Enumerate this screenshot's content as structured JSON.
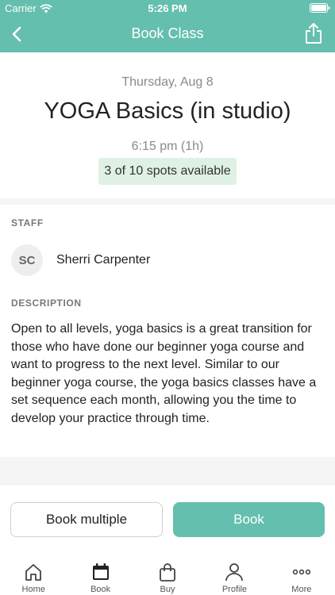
{
  "status_bar": {
    "carrier": "Carrier",
    "time": "5:26 PM"
  },
  "nav": {
    "title": "Book Class"
  },
  "class": {
    "date": "Thursday, Aug 8",
    "title": "YOGA Basics (in studio)",
    "time": "6:15 pm (1h)",
    "spots": "3 of 10 spots available"
  },
  "staff": {
    "label": "STAFF",
    "initials": "SC",
    "name": "Sherri Carpenter"
  },
  "description": {
    "label": "DESCRIPTION",
    "text": "Open to all levels, yoga basics is a great transition for those who have done our beginner yoga course and want to progress to the next level. Similar to our beginner yoga course, the yoga basics classes have a set sequence each month, allowing you the time to develop your practice through time."
  },
  "actions": {
    "book_multiple": "Book multiple",
    "book": "Book"
  },
  "tabs": [
    {
      "label": "Home",
      "icon": "home-icon"
    },
    {
      "label": "Book",
      "icon": "calendar-icon"
    },
    {
      "label": "Buy",
      "icon": "bag-icon"
    },
    {
      "label": "Profile",
      "icon": "person-icon"
    },
    {
      "label": "More",
      "icon": "more-icon"
    }
  ],
  "colors": {
    "accent": "#64bfae",
    "spots_bg": "#dff1e4"
  }
}
